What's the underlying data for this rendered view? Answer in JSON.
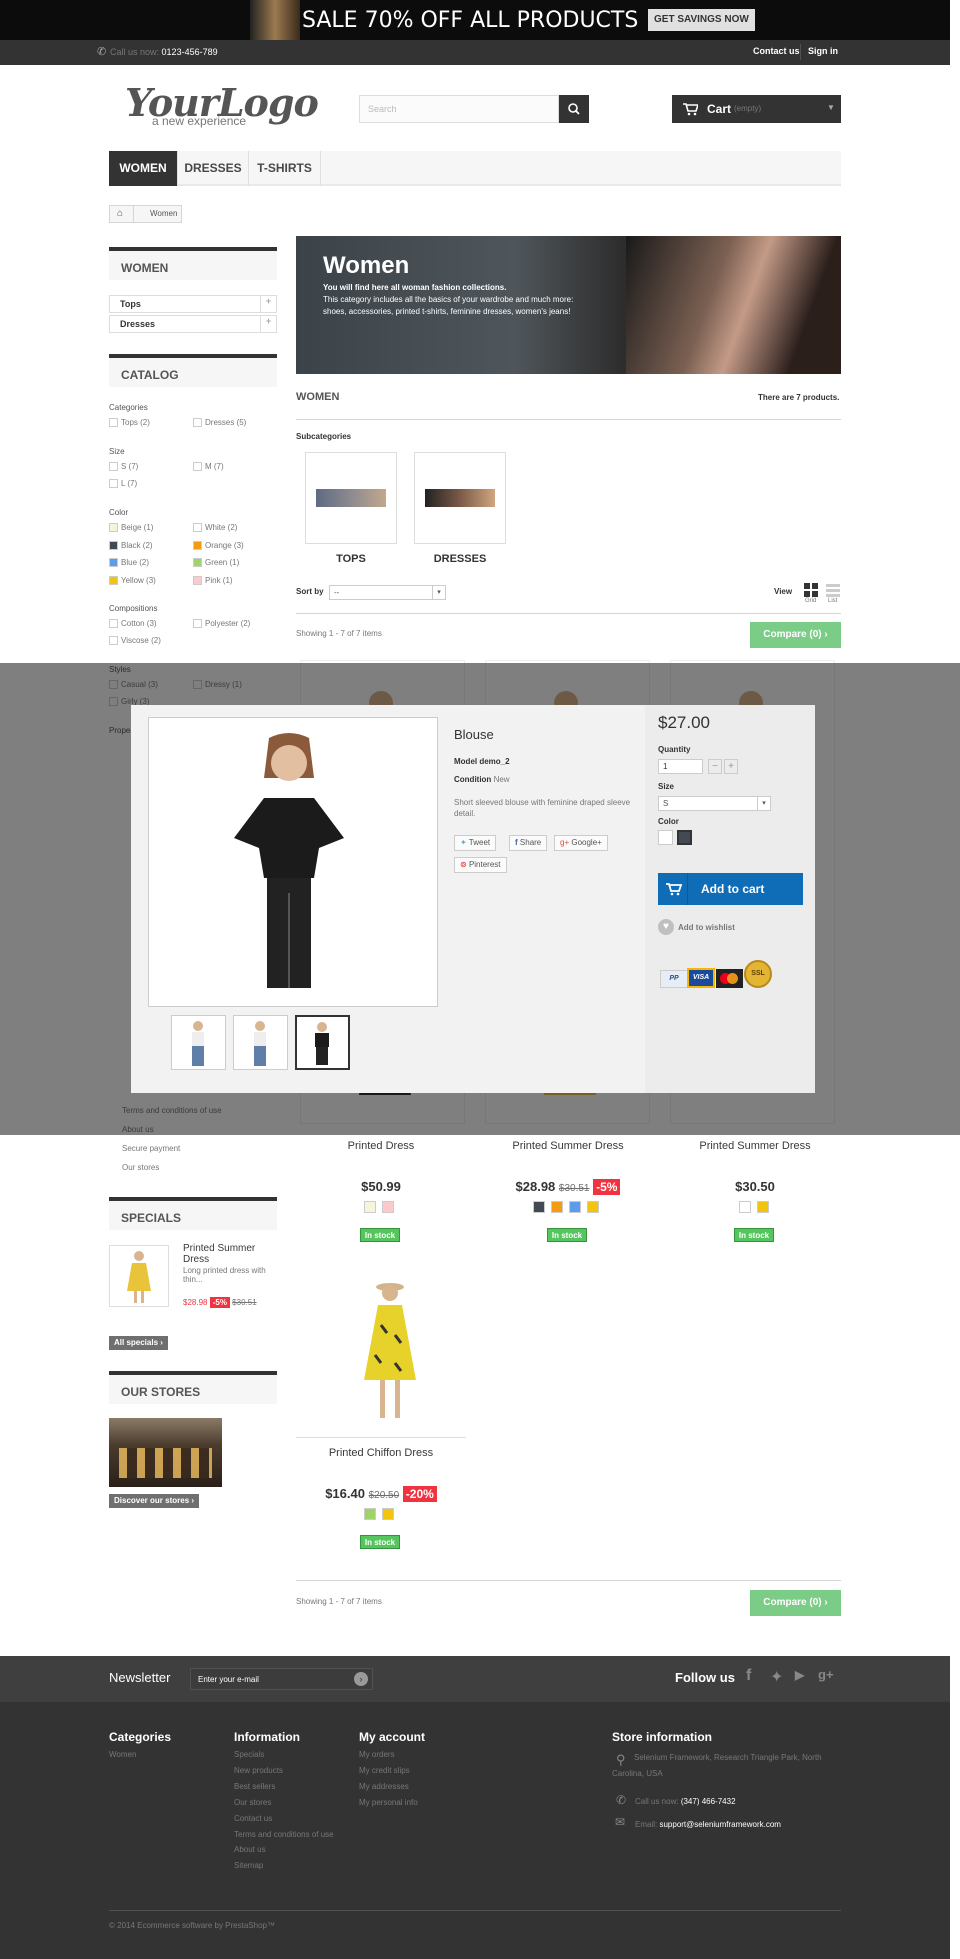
{
  "banner": {
    "text": "SALE 70% OFF ALL PRODUCTS",
    "button": "GET SAVINGS NOW"
  },
  "topbar": {
    "call_label": "Call us now:",
    "phone": "0123-456-789",
    "contact": "Contact us",
    "signin": "Sign in"
  },
  "logo": {
    "main": "YourLogo",
    "tagline": "a new experience"
  },
  "search": {
    "placeholder": "Search"
  },
  "cart": {
    "label": "Cart",
    "status": "(empty)"
  },
  "nav": [
    "WOMEN",
    "DRESSES",
    "T-SHIRTS"
  ],
  "breadcrumb": {
    "current": "Women"
  },
  "sidebar": {
    "women_title": "WOMEN",
    "women_items": [
      "Tops",
      "Dresses"
    ],
    "catalog_title": "CATALOG",
    "categories_label": "Categories",
    "categories": [
      "Tops (2)",
      "Dresses (5)"
    ],
    "size_label": "Size",
    "sizes": [
      "S (7)",
      "M (7)",
      "L (7)"
    ],
    "color_label": "Color",
    "colors": [
      {
        "name": "Beige (1)",
        "hex": "#f5f5dc"
      },
      {
        "name": "White (2)",
        "hex": "#ffffff"
      },
      {
        "name": "Black (2)",
        "hex": "#434a54"
      },
      {
        "name": "Orange (3)",
        "hex": "#f39c11"
      },
      {
        "name": "Blue (2)",
        "hex": "#5d9cec"
      },
      {
        "name": "Green (1)",
        "hex": "#a0d468"
      },
      {
        "name": "Yellow (3)",
        "hex": "#f1c40f"
      },
      {
        "name": "Pink (1)",
        "hex": "#fccacd"
      }
    ],
    "compositions_label": "Compositions",
    "compositions": [
      "Cotton (3)",
      "Polyester (2)",
      "Viscose (2)"
    ],
    "styles_label": "Styles",
    "styles": [
      "Casual (3)",
      "Dressy (1)",
      "Girly (3)"
    ],
    "properties_label": "Properties",
    "info_links": [
      "Terms and conditions of use",
      "About us",
      "Secure payment",
      "Our stores"
    ],
    "specials_title": "SPECIALS",
    "special": {
      "name": "Printed Summer Dress",
      "desc": "Long printed dress with thin...",
      "price": "$28.98",
      "discount": "-5%",
      "old": "$30.51"
    },
    "all_specials": "All specials",
    "stores_title": "OUR STORES",
    "discover": "Discover our stores"
  },
  "hero": {
    "title": "Women",
    "line1": "You will find here all woman fashion collections.",
    "line2": "This category includes all the basics of your wardrobe and much more: shoes, accessories, printed t-shirts, feminine dresses, women's jeans!"
  },
  "listing": {
    "title": "WOMEN",
    "count": "There are 7 products.",
    "subcategories_label": "Subcategories",
    "subcats": [
      "TOPS",
      "DRESSES"
    ],
    "sort_label": "Sort by",
    "sort_value": "--",
    "view_label": "View",
    "grid": "Grid",
    "list": "List",
    "showing": "Showing 1 - 7 of 7 items",
    "compare": "Compare (0)"
  },
  "products": [
    {
      "name": "Printed Dress",
      "price": "$50.99",
      "old": "",
      "discount": "",
      "colors": [
        "#f5f5dc",
        "#fccacd"
      ],
      "stock": "In stock"
    },
    {
      "name": "Printed Summer Dress",
      "price": "$28.98",
      "old": "$30.51",
      "discount": "-5%",
      "colors": [
        "#434a54",
        "#f39c11",
        "#5d9cec",
        "#f1c40f"
      ],
      "stock": "In stock"
    },
    {
      "name": "Printed Summer Dress",
      "price": "$30.50",
      "old": "",
      "discount": "",
      "colors": [
        "#ffffff",
        "#f1c40f"
      ],
      "stock": "In stock"
    },
    {
      "name": "Printed Chiffon Dress",
      "price": "$16.40",
      "old": "$20.50",
      "discount": "-20%",
      "colors": [
        "#a0d468",
        "#f1c40f"
      ],
      "stock": "In stock"
    }
  ],
  "quickview": {
    "name": "Blouse",
    "model_label": "Model",
    "model": "demo_2",
    "condition_label": "Condition",
    "condition": "New",
    "desc": "Short sleeved blouse with feminine draped sleeve detail.",
    "share": [
      "Tweet",
      "Share",
      "Google+",
      "Pinterest"
    ],
    "price": "$27.00",
    "quantity_label": "Quantity",
    "quantity": "1",
    "size_label": "Size",
    "size": "S",
    "color_label": "Color",
    "add_to_cart": "Add to cart",
    "wishlist": "Add to wishlist"
  },
  "footer": {
    "newsletter": "Newsletter",
    "newsletter_placeholder": "Enter your e-mail",
    "follow": "Follow us",
    "categories_title": "Categories",
    "categories": [
      "Women"
    ],
    "info_title": "Information",
    "info": [
      "Specials",
      "New products",
      "Best sellers",
      "Our stores",
      "Contact us",
      "Terms and conditions of use",
      "About us",
      "Sitemap"
    ],
    "account_title": "My account",
    "account": [
      "My orders",
      "My credit slips",
      "My addresses",
      "My personal info"
    ],
    "store_title": "Store information",
    "address": "Selenium Framework, Research Triangle Park, North Carolina, USA",
    "call_label": "Call us now:",
    "phone": "(347) 466-7432",
    "email_label": "Email:",
    "email": "support@seleniumframework.com",
    "copyright": "© 2014 Ecommerce software by PrestaShop™"
  }
}
